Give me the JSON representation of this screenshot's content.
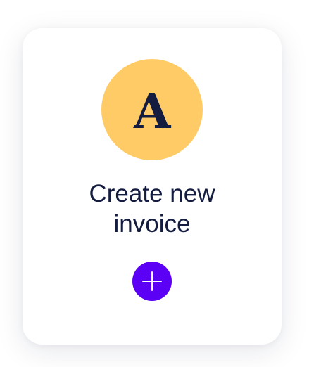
{
  "card": {
    "logo_letter": "A",
    "logo_icon": "serif-a-monogram-icon",
    "title_line1": "Create new",
    "title_line2": "invoice",
    "add_icon": "plus-icon"
  },
  "colors": {
    "logo_background": "#FFCB66",
    "logo_letter": "#141C40",
    "title_text": "#141C40",
    "add_button": "#5B00F5",
    "add_icon": "#FFFFFF"
  }
}
